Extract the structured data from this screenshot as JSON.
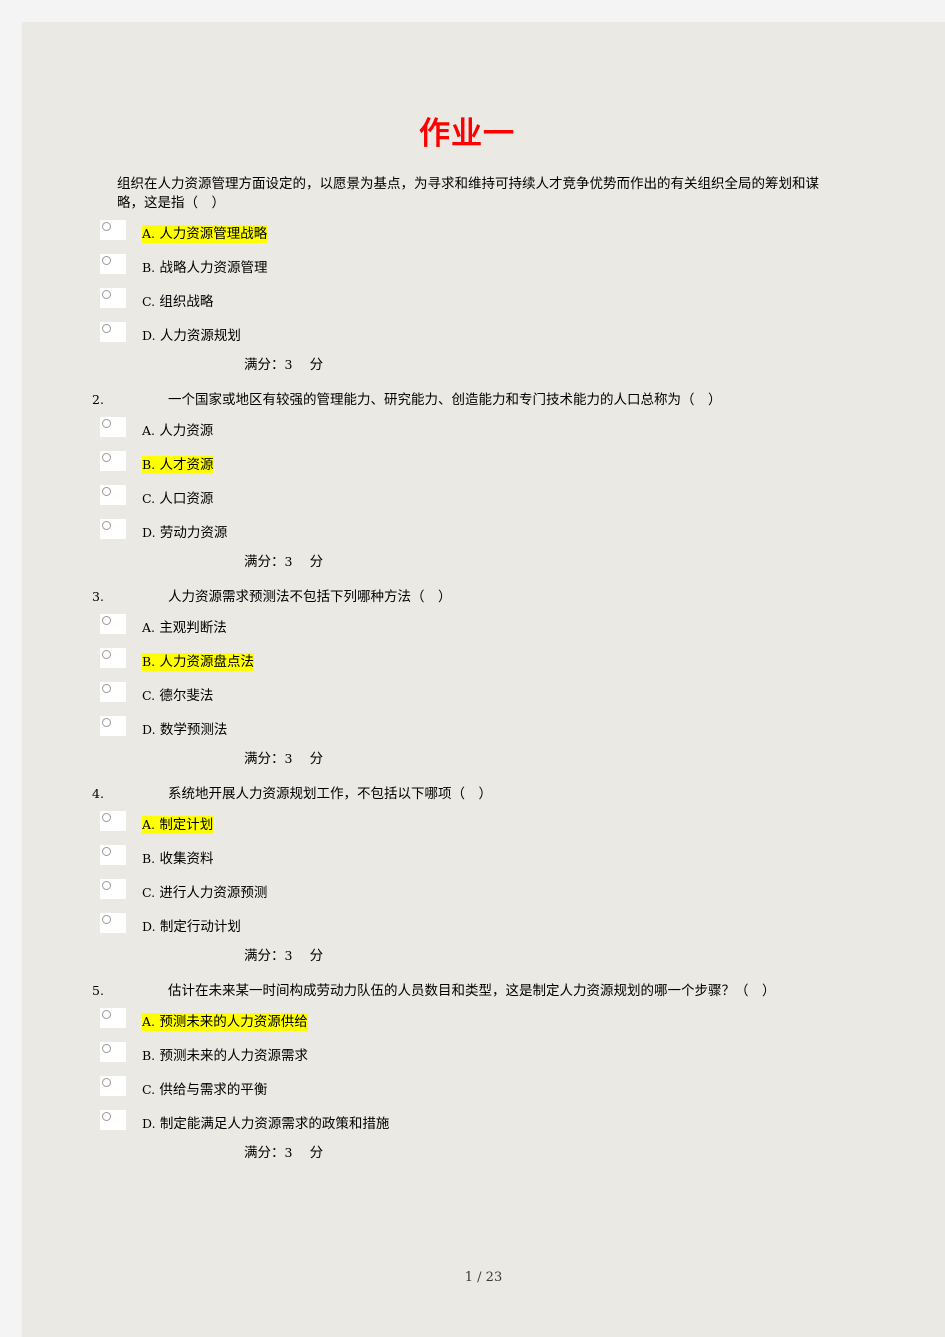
{
  "document": {
    "title": "作业一",
    "title_color": "#ff0000",
    "page_background": "#ebe9e4",
    "outer_background": "#f4f4f5",
    "highlight_color": "#ffff00",
    "footer": "1 / 23"
  },
  "questions": [
    {
      "number": "",
      "text": "组织在人力资源管理方面设定的，以愿景为基点，为寻求和维持可持续人才竞争优势而作出的有关组织全局的筹划和谋略，这是指（　）",
      "options": [
        {
          "letter": "A.",
          "text": "人力资源管理战略",
          "highlighted": true
        },
        {
          "letter": "B.",
          "text": "战略人力资源管理",
          "highlighted": false
        },
        {
          "letter": "C.",
          "text": "组织战略",
          "highlighted": false
        },
        {
          "letter": "D.",
          "text": "人力资源规划",
          "highlighted": false
        }
      ],
      "score_label": "满分：",
      "score_value": "3",
      "score_unit": "分"
    },
    {
      "number": "2.",
      "text": "一个国家或地区有较强的管理能力、研究能力、创造能力和专门技术能力的人口总称为（　）",
      "options": [
        {
          "letter": "A.",
          "text": "人力资源",
          "highlighted": false
        },
        {
          "letter": "B.",
          "text": "人才资源",
          "highlighted": true
        },
        {
          "letter": "C.",
          "text": "人口资源",
          "highlighted": false
        },
        {
          "letter": "D.",
          "text": "劳动力资源",
          "highlighted": false
        }
      ],
      "score_label": "满分：",
      "score_value": "3",
      "score_unit": "分"
    },
    {
      "number": "3.",
      "text": "人力资源需求预测法不包括下列哪种方法（　）",
      "options": [
        {
          "letter": "A.",
          "text": "主观判断法",
          "highlighted": false
        },
        {
          "letter": "B.",
          "text": "人力资源盘点法",
          "highlighted": true
        },
        {
          "letter": "C.",
          "text": "德尔斐法",
          "highlighted": false
        },
        {
          "letter": "D.",
          "text": "数学预测法",
          "highlighted": false
        }
      ],
      "score_label": "满分：",
      "score_value": "3",
      "score_unit": "分"
    },
    {
      "number": "4.",
      "text": "系统地开展人力资源规划工作，不包括以下哪项（　）",
      "options": [
        {
          "letter": "A.",
          "text": "制定计划",
          "highlighted": true
        },
        {
          "letter": "B.",
          "text": "收集资料",
          "highlighted": false
        },
        {
          "letter": "C.",
          "text": "进行人力资源预测",
          "highlighted": false
        },
        {
          "letter": "D.",
          "text": "制定行动计划",
          "highlighted": false
        }
      ],
      "score_label": "满分：",
      "score_value": "3",
      "score_unit": "分"
    },
    {
      "number": "5.",
      "text": "估计在未来某一时间构成劳动力队伍的人员数目和类型，这是制定人力资源规划的哪一个步骤？（　）",
      "options": [
        {
          "letter": "A.",
          "text": "预测未来的人力资源供给",
          "highlighted": true
        },
        {
          "letter": "B.",
          "text": "预测未来的人力资源需求",
          "highlighted": false
        },
        {
          "letter": "C.",
          "text": "供给与需求的平衡",
          "highlighted": false
        },
        {
          "letter": "D.",
          "text": "制定能满足人力资源需求的政策和措施",
          "highlighted": false
        }
      ],
      "score_label": "满分：",
      "score_value": "3",
      "score_unit": "分"
    }
  ]
}
